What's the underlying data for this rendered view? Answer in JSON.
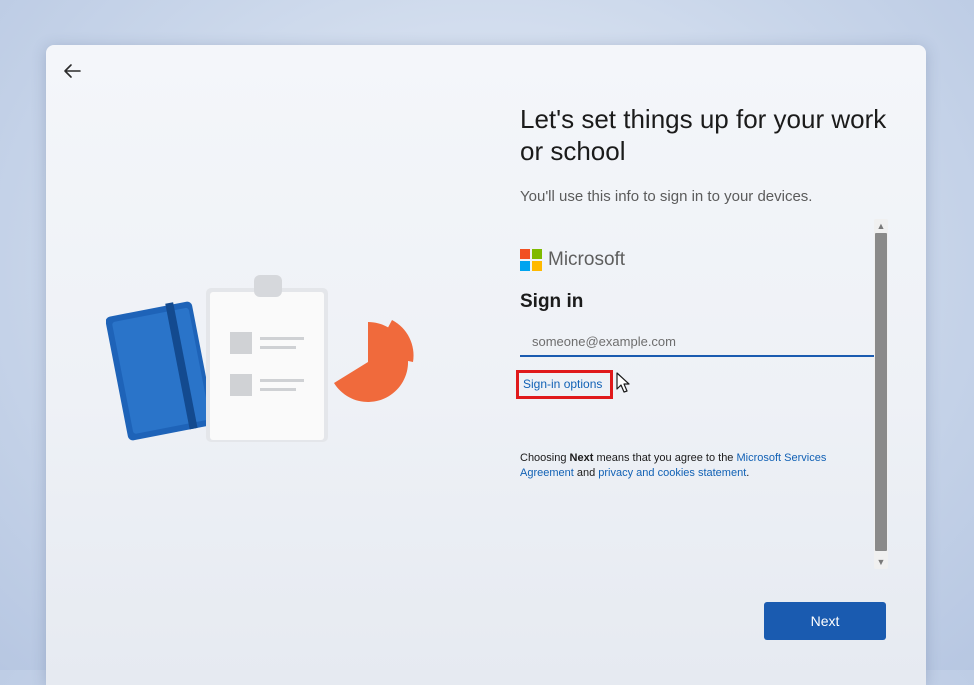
{
  "page": {
    "heading": "Let's set things up for your work or school",
    "subtext": "You'll use this info to sign in to your devices."
  },
  "signin": {
    "brand": "Microsoft",
    "title": "Sign in",
    "email_placeholder": "someone@example.com",
    "email_value": "",
    "options_link": "Sign-in options"
  },
  "agreement": {
    "prefix": "Choosing ",
    "bold": "Next",
    "middle": " means that you agree to the ",
    "link1": "Microsoft Services Agreement",
    "and": " and ",
    "link2": "privacy and cookies statement",
    "suffix": "."
  },
  "footer": {
    "next_label": "Next"
  },
  "icons": {
    "back": "back-arrow-icon",
    "logo": "microsoft-logo-icon",
    "cursor": "mouse-cursor-icon"
  },
  "colors": {
    "accent": "#1a5bb0",
    "link": "#1161b5",
    "highlight_box": "#e0191b",
    "ms_red": "#f25022",
    "ms_green": "#7fba00",
    "ms_blue": "#00a4ef",
    "ms_yellow": "#ffb900"
  }
}
